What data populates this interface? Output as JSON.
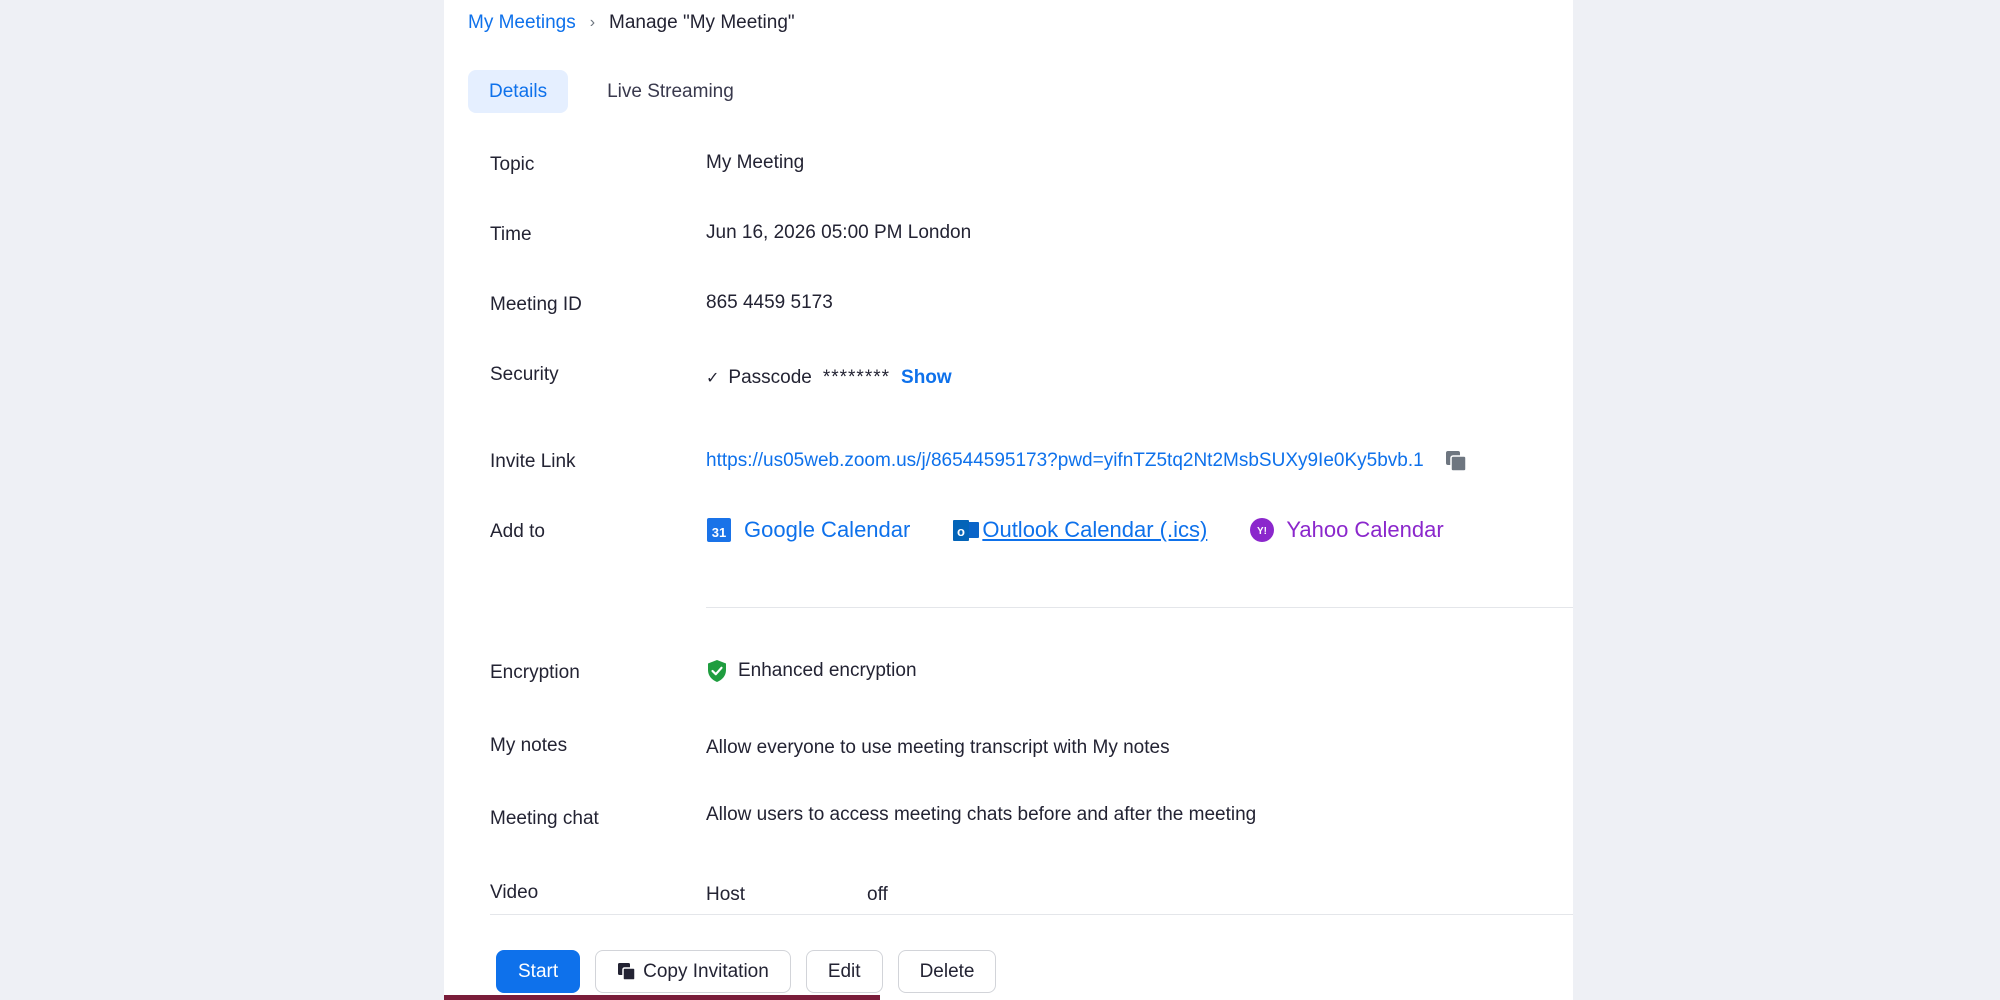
{
  "breadcrumb": {
    "parent": "My Meetings",
    "separator": "›",
    "current": "Manage \"My Meeting\""
  },
  "tabs": [
    {
      "label": "Details",
      "active": true
    },
    {
      "label": "Live Streaming",
      "active": false
    }
  ],
  "fields": {
    "topic": {
      "label": "Topic",
      "value": "My Meeting"
    },
    "time": {
      "label": "Time",
      "value": "Jun 16, 2026 05:00 PM London"
    },
    "meeting_id": {
      "label": "Meeting ID",
      "value": "865 4459 5173"
    },
    "security": {
      "label": "Security",
      "check": "✓",
      "passcode_label": "Passcode",
      "passcode_mask": "********",
      "show_label": "Show"
    },
    "invite_link": {
      "label": "Invite Link",
      "value": "https://us05web.zoom.us/j/86544595173?pwd=yifnTZ5tq2Nt2MsbSUXy9Ie0Ky5bvb.1",
      "copy_icon": "copy-icon"
    },
    "add_to": {
      "label": "Add to",
      "google": "Google Calendar",
      "google_icon_text": "31",
      "outlook": " Outlook Calendar (.ics)",
      "outlook_icon_text": "o",
      "yahoo": "Yahoo Calendar",
      "yahoo_icon_text": "Y!"
    },
    "encryption": {
      "label": "Encryption",
      "value": "Enhanced encryption"
    },
    "my_notes": {
      "label": "My notes",
      "value": "Allow everyone to use meeting transcript with My notes"
    },
    "meeting_chat": {
      "label": "Meeting chat",
      "value": "Allow users to access meeting chats before and after the meeting"
    },
    "video": {
      "label": "Video",
      "host_label": "Host",
      "host_value": "off"
    }
  },
  "actions": {
    "start": "Start",
    "copy_invitation": "Copy Invitation",
    "edit": "Edit",
    "delete": "Delete"
  },
  "colors": {
    "accent": "#0e71eb",
    "yahoo": "#8b27cc",
    "encryption_green": "#1f9d3f",
    "bottom_bar": "#7a1d3a"
  }
}
